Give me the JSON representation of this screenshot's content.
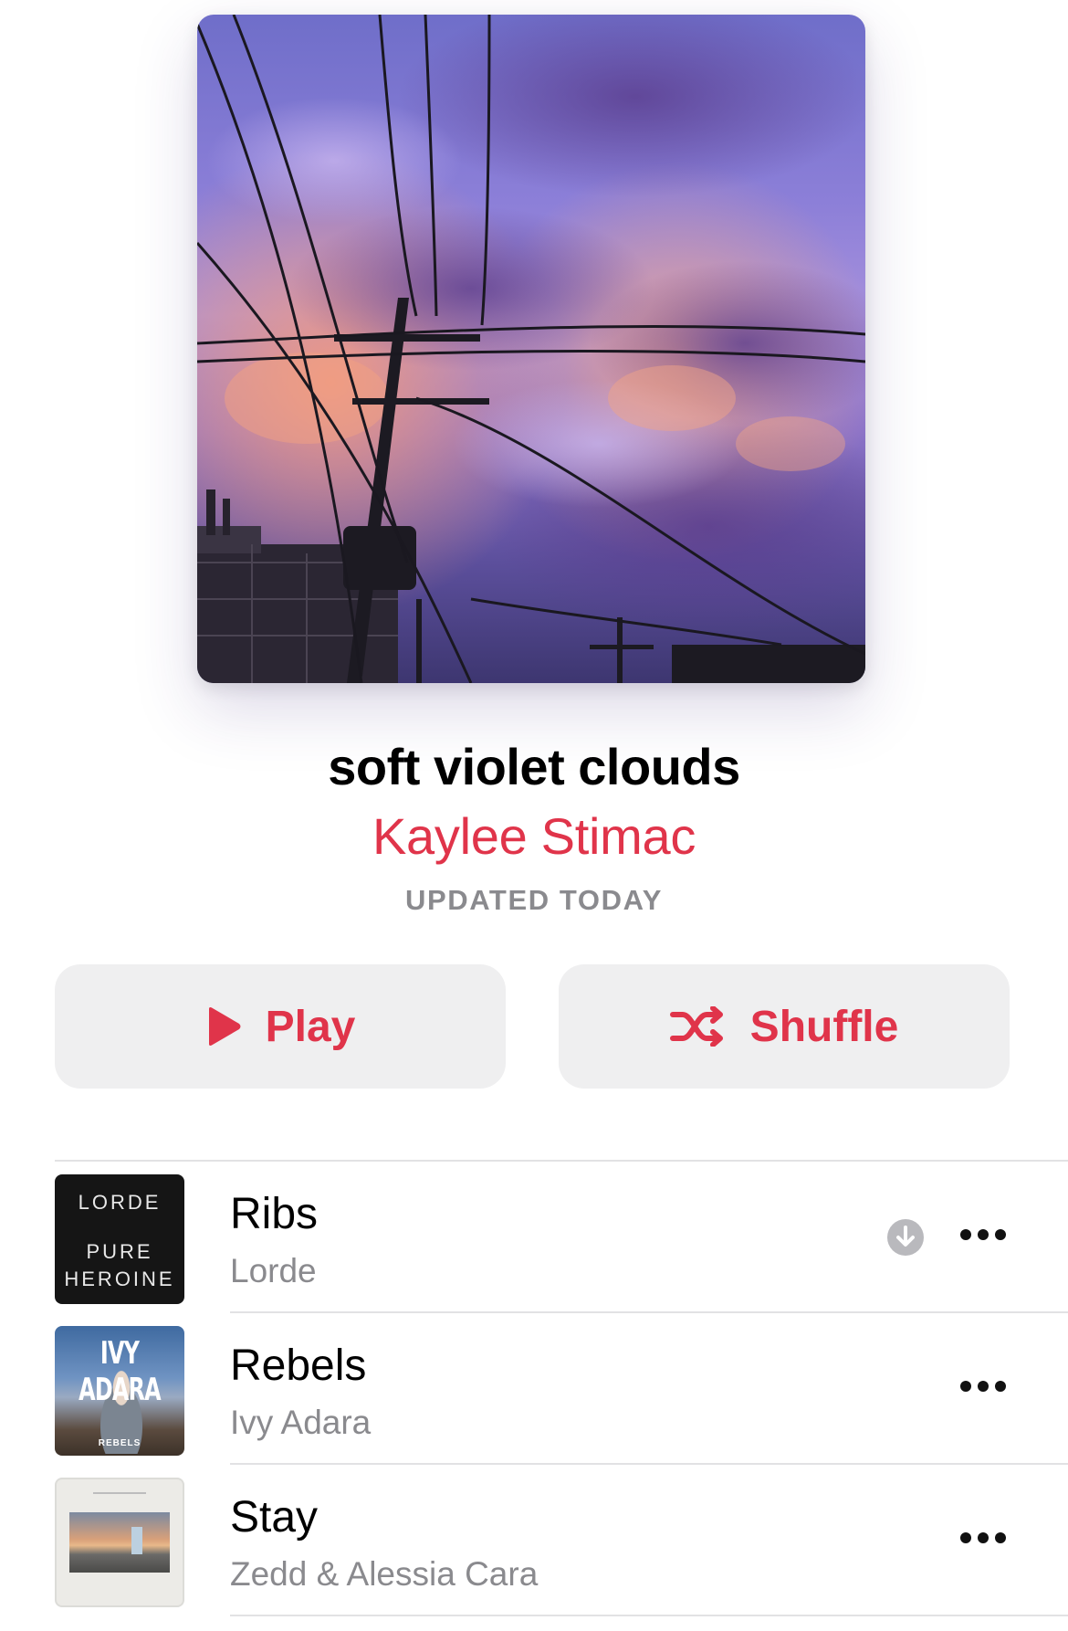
{
  "playlist": {
    "title": "soft violet clouds",
    "curator": "Kaylee Stimac",
    "updated": "UPDATED TODAY",
    "artwork_icon": "sunset-power-lines-artwork"
  },
  "actions": {
    "play_label": "Play",
    "shuffle_label": "Shuffle"
  },
  "colors": {
    "accent": "#e0344a",
    "secondary_text": "#8a8a8e",
    "button_bg": "#efeff0"
  },
  "songs": [
    {
      "title": "Ribs",
      "artist": "Lorde",
      "art": {
        "line1": "LORDE",
        "line2": "PURE",
        "line3": "HEROINE"
      },
      "downloaded_icon": "download-arrow-icon"
    },
    {
      "title": "Rebels",
      "artist": "Ivy Adara",
      "art": {
        "line1": "IVY ADARA",
        "line2": "REBELS"
      }
    },
    {
      "title": "Stay",
      "artist": "Zedd & Alessia Cara"
    }
  ]
}
